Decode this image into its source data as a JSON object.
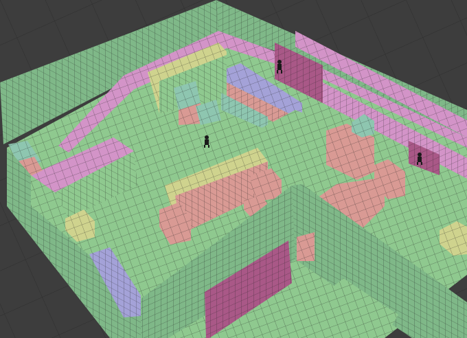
{
  "viewport": {
    "background_color": "#3d3d3d",
    "grid_line_color": "#2e2e2e",
    "grid_shown": true
  },
  "level": {
    "name": "",
    "tile_grid_shown": true,
    "material_colors": {
      "green": "#8fc98f",
      "green_wall": "#7fb888",
      "pink": "#d394c8",
      "salmon": "#d99a94",
      "teal": "#8ec6b0",
      "blue_violet": "#a4a2d8",
      "yellow": "#cfd38e",
      "dark_magenta": "#a95887"
    },
    "characters": [
      {
        "name": "player-figure-upper-balcony"
      },
      {
        "name": "player-figure-main-floor"
      },
      {
        "name": "player-figure-right-walkway"
      }
    ]
  }
}
